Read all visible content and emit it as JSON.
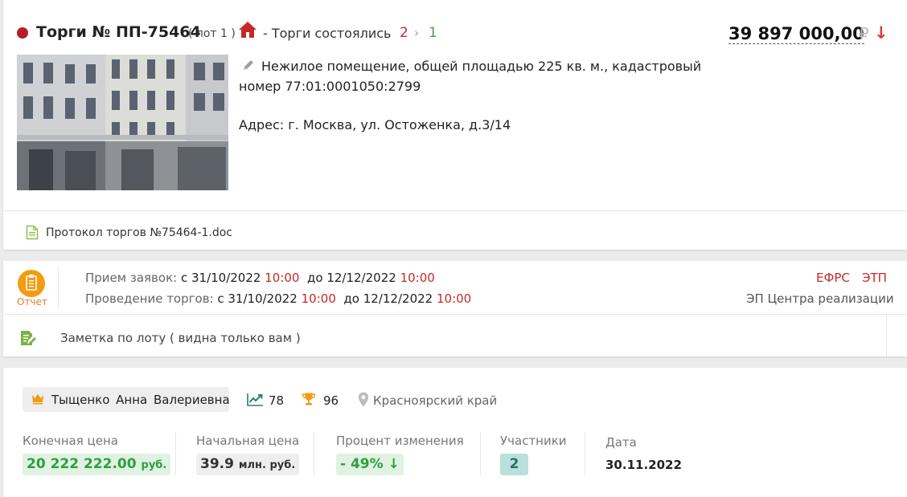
{
  "lot": {
    "title": "Торги № ПП-75464",
    "lot_number": "( лот 1 )",
    "status": "- Торги состоялись",
    "step_from": "2",
    "step_arrow": "›",
    "step_to": "1",
    "price": "39 897 000,00",
    "currency": "₽",
    "price_trend": "↓",
    "description": "Нежилое помещение, общей площадью 225 кв. м., кадастровый номер 77:01:0001050:2799",
    "address": "Адрес: г. Москва, ул. Остоженка, д.3/14",
    "document": "Протокол торгов №75464-1.doc",
    "icons": [
      "home-icon",
      "pencil-icon",
      "document-icon"
    ]
  },
  "schedule": {
    "report_label": "Отчет",
    "applications_label": "Прием заявок:",
    "applications_from": "с 31/10/2022",
    "applications_from_time": "10:00",
    "applications_to": "до 12/12/2022",
    "applications_to_time": "10:00",
    "auction_label": "Проведение торгов:",
    "auction_from": "с 31/10/2022",
    "auction_from_time": "10:00",
    "auction_to": "до 12/12/2022",
    "auction_to_time": "10:00",
    "efrs": "ЕФРС",
    "etp": "ЭТП",
    "platform": "ЭП Центра реализации",
    "note": "Заметка по лоту ( видна только вам )"
  },
  "result": {
    "winner": "Тыщенко Анна Валериевна",
    "trend_value": "78",
    "trophy_value": "96",
    "region": "Красноярский край",
    "final_price_label": "Конечная цена",
    "final_price": "20 222 222.00",
    "final_price_unit": "руб.",
    "start_price_label": "Начальная цена",
    "start_price": "39.9",
    "start_price_unit": "млн. руб.",
    "change_label": "Процент изменения",
    "change_value": "- 49%",
    "change_arrow": "↓",
    "participants_label": "Участники",
    "participants_value": "2",
    "date_label": "Дата",
    "date_value": "30.11.2022"
  },
  "colors": {
    "accent_red": "#c62828",
    "accent_green": "#2e9e3f",
    "accent_orange": "#f39c12",
    "accent_teal": "#b9e0dd"
  }
}
